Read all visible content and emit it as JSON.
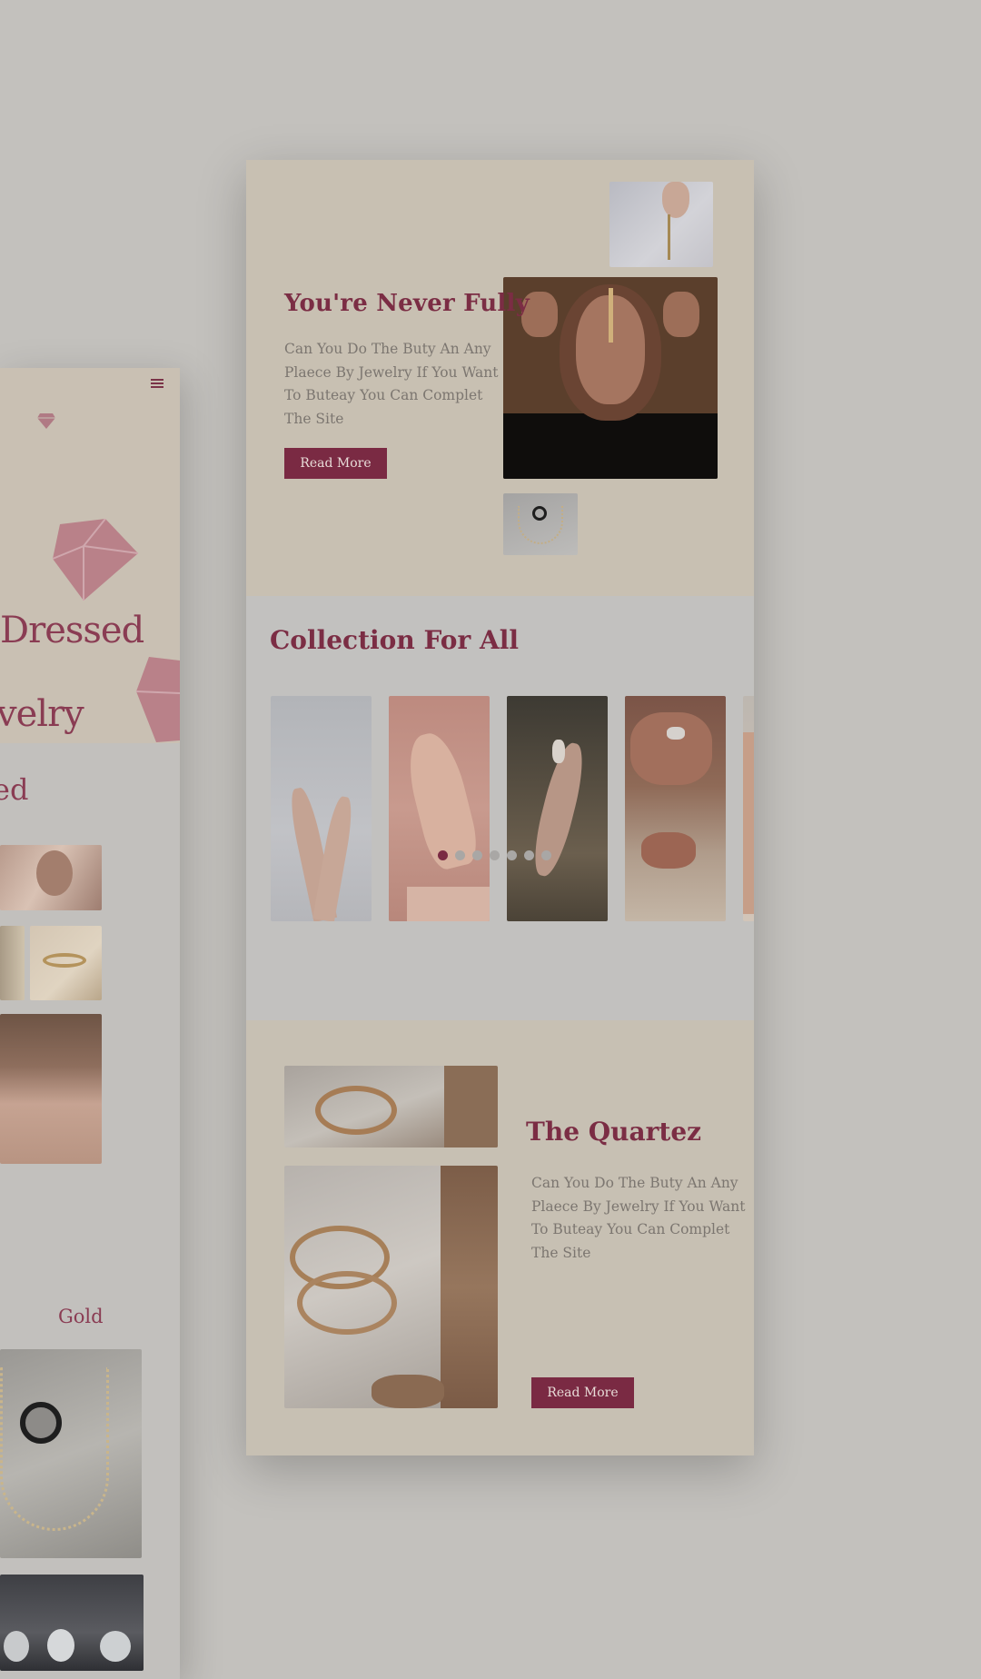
{
  "left_mockup": {
    "hero_title_line1": "Dressed",
    "hero_title_line2": "velry",
    "section_title": "ed",
    "tab_gold": "Gold"
  },
  "main": {
    "hero": {
      "title": "You're Never Fully",
      "body": "Can You Do The Buty An Any Plaece By Jewelry If You Want To Buteay You Can Complet The Site",
      "button": "Read More"
    },
    "collection": {
      "title": "Collection For All",
      "slides": [
        "hands-photo-1",
        "hands-photo-2",
        "hands-photo-3",
        "hands-photo-4",
        "hands-photo-5"
      ],
      "dot_count": 7,
      "active_dot": 0
    },
    "quartez": {
      "title": "The Quartez",
      "body": "Can You Do The Buty An Any Plaece By Jewelry If You Want To Buteay You Can Complet The Site",
      "button": "Read More"
    }
  },
  "colors": {
    "accent": "#7a2a43",
    "hero_bg": "#c8c0b2",
    "page_bg": "#c3c1bd"
  },
  "icons": [
    "hamburger-icon",
    "diamond-logo-icon",
    "diamond-decor-icon"
  ]
}
